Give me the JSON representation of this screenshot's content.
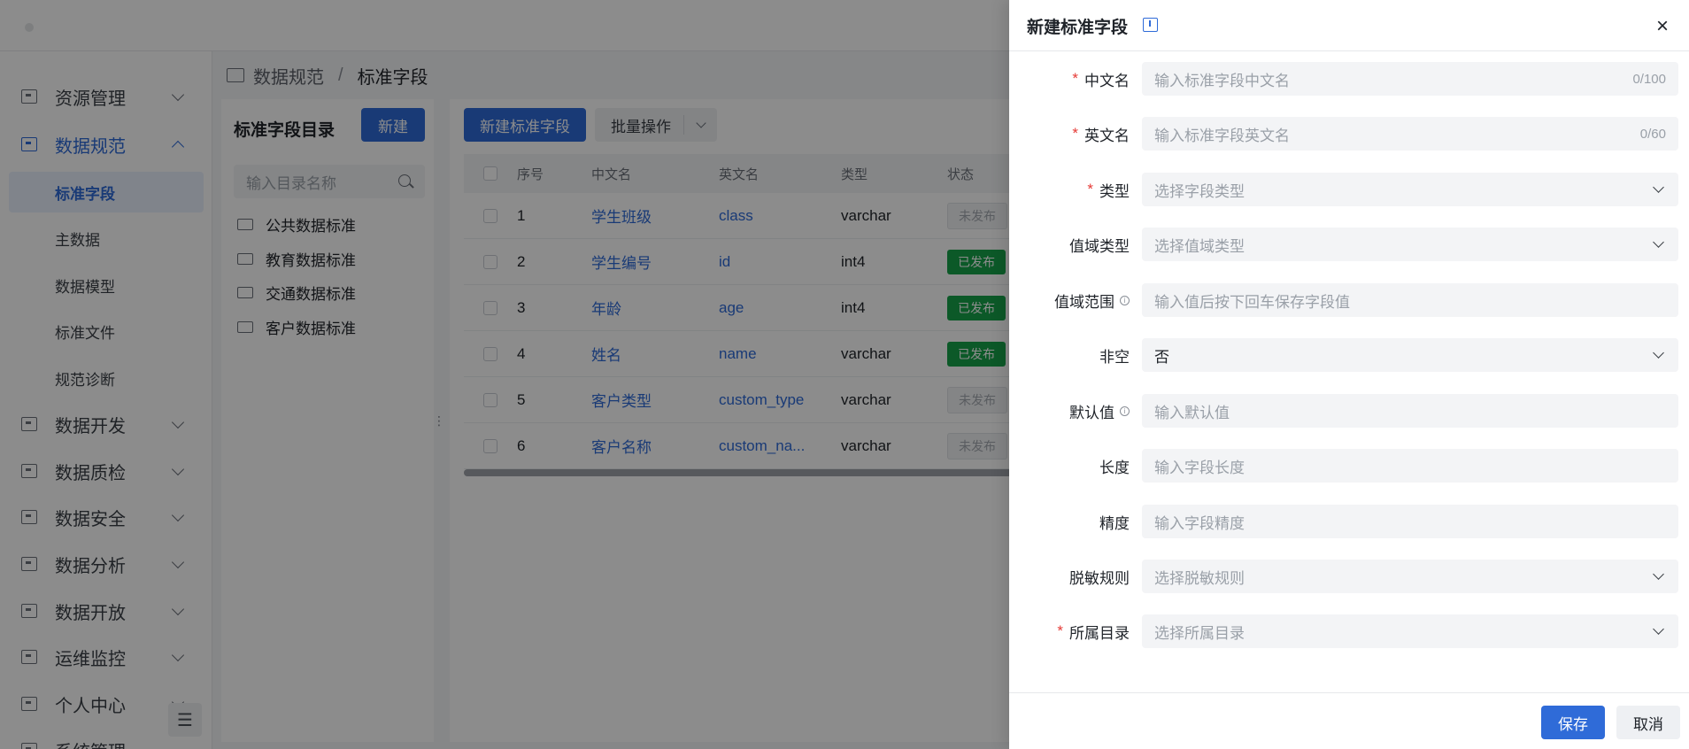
{
  "sidebar": {
    "items": [
      {
        "label": "资源管理",
        "icon": "monitor-icon"
      },
      {
        "label": "数据规范",
        "icon": "monitor-icon",
        "open": true
      },
      {
        "label": "数据开发",
        "icon": "code-icon"
      },
      {
        "label": "数据质检",
        "icon": "monitor-icon"
      },
      {
        "label": "数据安全",
        "icon": "shield-icon"
      },
      {
        "label": "数据分析",
        "icon": "chart-icon"
      },
      {
        "label": "数据开放",
        "icon": "share-icon"
      },
      {
        "label": "运维监控",
        "icon": "pulse-icon"
      },
      {
        "label": "个人中心",
        "icon": "user-icon"
      },
      {
        "label": "系统管理",
        "icon": "settings-icon"
      }
    ],
    "sub_items": [
      "标准字段",
      "主数据",
      "数据模型",
      "标准文件",
      "规范诊断"
    ],
    "collapse_glyph": "☰"
  },
  "breadcrumb": {
    "parent": "数据规范",
    "separator": "/",
    "current": "标准字段"
  },
  "tree": {
    "title": "标准字段目录",
    "new_label": "新建",
    "search_placeholder": "输入目录名称",
    "nodes": [
      "公共数据标准",
      "教育数据标准",
      "交通数据标准",
      "客户数据标准"
    ]
  },
  "toolbar": {
    "create_label": "新建标准字段",
    "batch_label": "批量操作"
  },
  "table": {
    "columns": [
      "序号",
      "中文名",
      "英文名",
      "类型",
      "状态"
    ],
    "rows": [
      {
        "idx": "1",
        "cn": "学生班级",
        "en": "class",
        "type": "varchar",
        "status": "未发布"
      },
      {
        "idx": "2",
        "cn": "学生编号",
        "en": "id",
        "type": "int4",
        "status": "已发布"
      },
      {
        "idx": "3",
        "cn": "年龄",
        "en": "age",
        "type": "int4",
        "status": "已发布"
      },
      {
        "idx": "4",
        "cn": "姓名",
        "en": "name",
        "type": "varchar",
        "status": "已发布"
      },
      {
        "idx": "5",
        "cn": "客户类型",
        "en": "custom_type",
        "type": "varchar",
        "status": "未发布"
      },
      {
        "idx": "6",
        "cn": "客户名称",
        "en": "custom_na...",
        "type": "varchar",
        "status": "未发布"
      }
    ]
  },
  "drawer": {
    "title": "新建标准字段",
    "close_glyph": "×",
    "fields": [
      {
        "label": "中文名",
        "required": true,
        "placeholder": "输入标准字段中文名",
        "count": "0/100",
        "kind": "input"
      },
      {
        "label": "英文名",
        "required": true,
        "placeholder": "输入标准字段英文名",
        "count": "0/60",
        "kind": "input"
      },
      {
        "label": "类型",
        "required": true,
        "placeholder": "选择字段类型",
        "kind": "select"
      },
      {
        "label": "值域类型",
        "required": false,
        "placeholder": "选择值域类型",
        "kind": "select"
      },
      {
        "label": "值域范围",
        "required": false,
        "info": true,
        "placeholder": "输入值后按下回车保存字段值",
        "kind": "input"
      },
      {
        "label": "非空",
        "required": false,
        "value": "否",
        "kind": "select"
      },
      {
        "label": "默认值",
        "required": false,
        "info": true,
        "placeholder": "输入默认值",
        "kind": "input"
      },
      {
        "label": "长度",
        "required": false,
        "placeholder": "输入字段长度",
        "kind": "input"
      },
      {
        "label": "精度",
        "required": false,
        "placeholder": "输入字段精度",
        "kind": "input"
      },
      {
        "label": "脱敏规则",
        "required": false,
        "placeholder": "选择脱敏规则",
        "kind": "select"
      },
      {
        "label": "所属目录",
        "required": true,
        "placeholder": "选择所属目录",
        "kind": "select"
      }
    ],
    "required_mark": "*",
    "info_glyph": "i",
    "save_label": "保存",
    "cancel_label": "取消"
  },
  "colors": {
    "primary": "#2f6bd8",
    "success": "#16a34a",
    "required": "#e53935"
  }
}
